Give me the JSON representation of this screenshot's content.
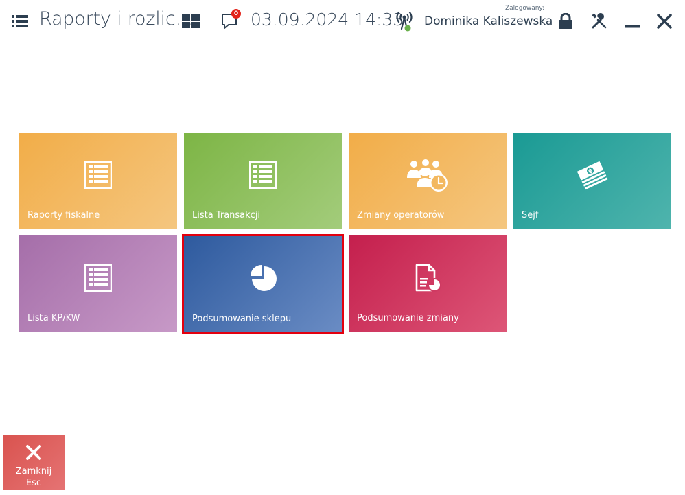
{
  "header": {
    "title": "Raporty i rozlic...",
    "notifications_count": "0",
    "datetime": "03.09.2024 14:33",
    "logged_label": "Zalogowany:",
    "user_name": "Dominika Kaliszewska"
  },
  "tiles": [
    {
      "label": "Raporty fiskalne",
      "icon": "table-icon",
      "color": "#f2ad48"
    },
    {
      "label": "Lista Transakcji",
      "icon": "table-icon",
      "color": "#7db545"
    },
    {
      "label": "Zmiany operatorów",
      "icon": "operators-clock-icon",
      "color": "#f2ad48"
    },
    {
      "label": "Sejf",
      "icon": "money-stack-icon",
      "color": "#1a9a94"
    },
    {
      "label": "Lista KP/KW",
      "icon": "table-icon",
      "color": "#a56ea9"
    },
    {
      "label": "Podsumowanie sklepu",
      "icon": "pie-chart-icon",
      "color": "#2e5a9e",
      "selected": true
    },
    {
      "label": "Podsumowanie zmiany",
      "icon": "document-chart-icon",
      "color": "#c41f4d"
    }
  ],
  "footer": {
    "close_label_line1": "Zamknij",
    "close_label_line2": "Esc",
    "close_color": "#d9534f"
  },
  "colors": {
    "accent_selected_border": "#e3000f",
    "badge": "#e2231a"
  }
}
